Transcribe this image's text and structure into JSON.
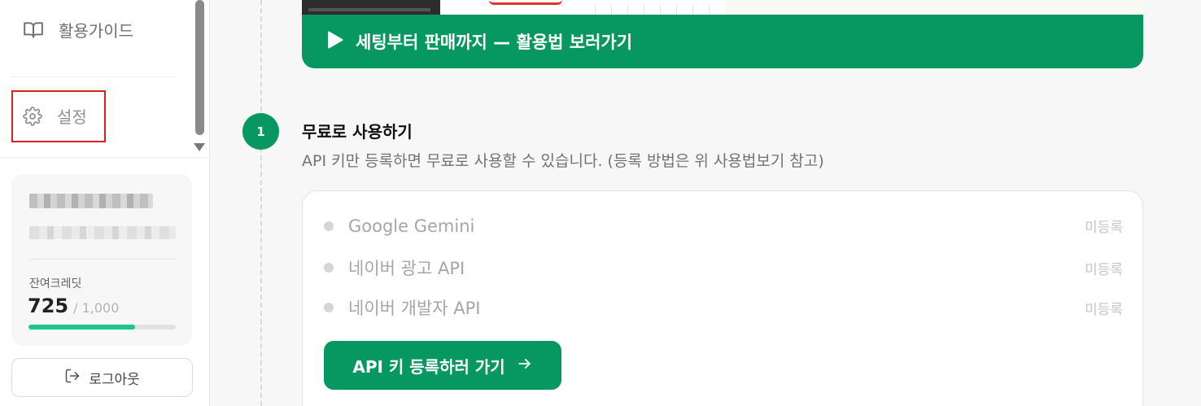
{
  "sidebar": {
    "nav": {
      "guide_label": "활용가이드",
      "settings_label": "설정"
    },
    "profile": {
      "credit_label": "잔여크레딧",
      "credit_value": "725",
      "credit_total": "/ 1,000",
      "credit_fraction": 0.725
    },
    "logout_label": "로그아웃"
  },
  "main": {
    "video_cta_label": "세팅부터 판매까지 — 활용법 보러가기",
    "step": {
      "number": "1",
      "title": "무료로 사용하기",
      "description": "API 키만 등록하면 무료로 사용할 수 있습니다. (등록 방법은 위 사용법보기 참고)"
    },
    "apis": [
      {
        "name": "Google Gemini",
        "status": "미등록"
      },
      {
        "name": "네이버 광고 API",
        "status": "미등록"
      },
      {
        "name": "네이버 개발자 API",
        "status": "미등록"
      }
    ],
    "register_button_label": "API 키 등록하러 가기"
  },
  "colors": {
    "accent_green": "#079862",
    "progress_green": "#1fc48a",
    "highlight_red": "#d92020"
  }
}
